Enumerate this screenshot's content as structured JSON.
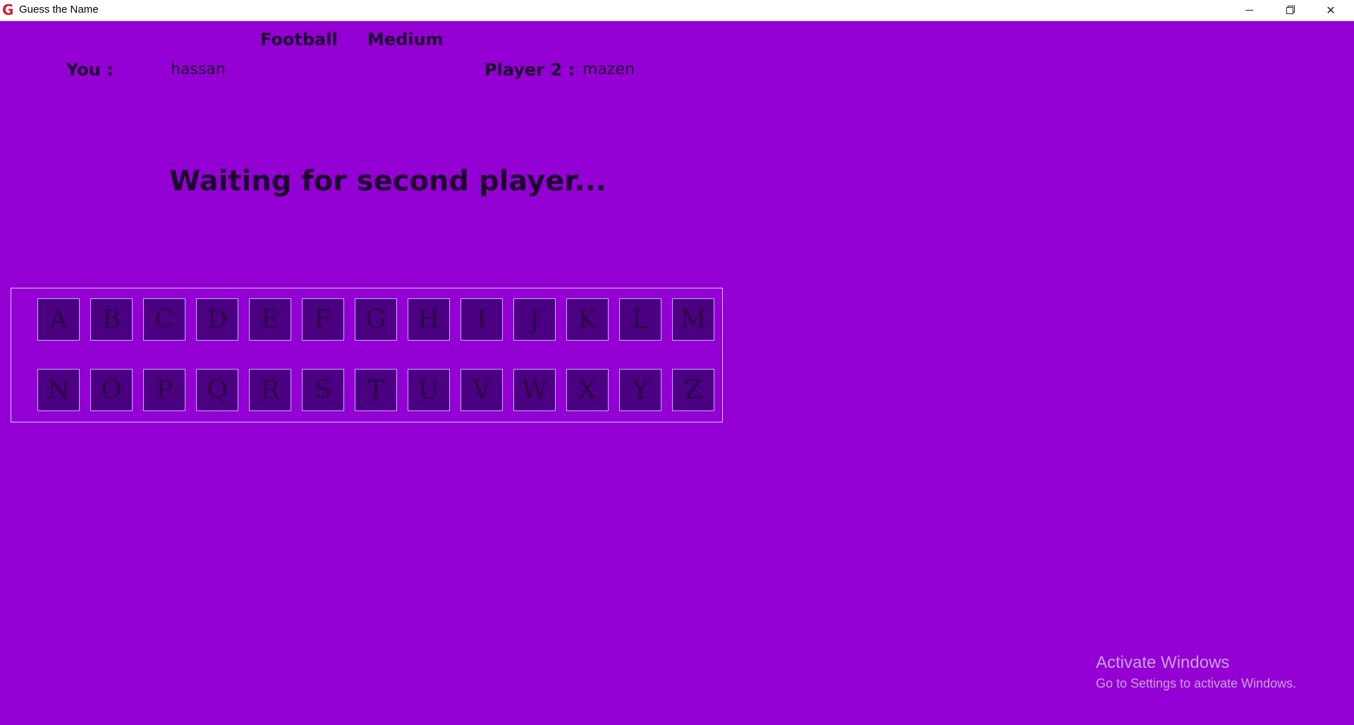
{
  "window": {
    "title": "Guess the Name",
    "icon": "G",
    "controls": [
      "minimize-icon",
      "maximize-icon",
      "close-icon"
    ],
    "close_glyph": "✕"
  },
  "game": {
    "category": "Football",
    "difficulty": "Medium",
    "you_label": "You :",
    "you_name": "hassan",
    "player2_label": "Player 2 :",
    "player2_name": "mazen",
    "status": "Waiting for second player..."
  },
  "keyboard": {
    "row1": [
      "A",
      "B",
      "C",
      "D",
      "E",
      "F",
      "G",
      "H",
      "I",
      "J",
      "K",
      "L",
      "M"
    ],
    "row2": [
      "N",
      "O",
      "P",
      "Q",
      "R",
      "S",
      "T",
      "U",
      "V",
      "W",
      "X",
      "Y",
      "Z"
    ]
  },
  "watermark": {
    "line1": "Activate Windows",
    "line2": "Go to Settings to activate Windows."
  },
  "colors": {
    "background": "#9400d3",
    "key_fill": "#4b0082",
    "key_border": "#c9a9ff",
    "text": "#1e0030"
  }
}
